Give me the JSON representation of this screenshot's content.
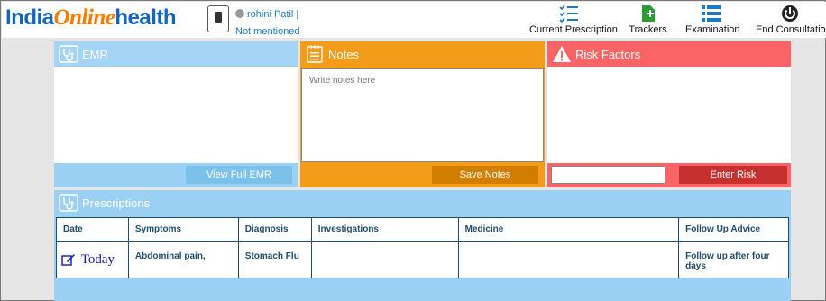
{
  "app": {
    "logo_part1": "India",
    "logo_part2": "Online",
    "logo_part3": "health"
  },
  "patient": {
    "name": "rohini Patil",
    "separator": "|",
    "subtitle": "Not mentioned"
  },
  "nav": [
    {
      "label": "Current Prescription",
      "icon": "checklist-icon"
    },
    {
      "label": "Trackers",
      "icon": "add-document-icon"
    },
    {
      "label": "Examination",
      "icon": "list-icon"
    },
    {
      "label": "End Consultation",
      "icon": "power-icon"
    }
  ],
  "emr": {
    "title": "EMR",
    "button": "View Full EMR"
  },
  "notes": {
    "title": "Notes",
    "placeholder": "Write notes here",
    "button": "Save Notes"
  },
  "risk": {
    "title": "Risk Factors",
    "input_value": "",
    "button": "Enter Risk"
  },
  "prescriptions": {
    "title": "Prescriptions",
    "columns": [
      "Date",
      "Symptoms",
      "Diagnosis",
      "Investigations",
      "Medicine",
      "Follow Up Advice"
    ],
    "rows": [
      {
        "date": "Today",
        "symptoms": "Abdominal pain,",
        "diagnosis": "Stomach Flu",
        "investigations": "",
        "medicine": "",
        "follow_up": "Follow up after four days"
      }
    ]
  },
  "colors": {
    "emr_header": "#a3d3f5",
    "emr_footer": "#99d0f4",
    "emr_button": "#7cc0ec",
    "notes_header": "#f29c1a",
    "notes_button": "#d17d00",
    "risk_header": "#fb6466",
    "risk_button": "#c6302e",
    "logo_blue": "#1565c0",
    "logo_orange": "#f57c00"
  }
}
